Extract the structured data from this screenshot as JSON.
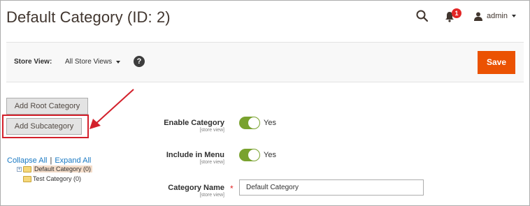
{
  "header": {
    "title": "Default Category (ID: 2)",
    "notifications_count": "1",
    "user_name": "admin"
  },
  "toolbar": {
    "store_view_label": "Store View:",
    "store_view_value": "All Store Views",
    "help_label": "?",
    "save_label": "Save"
  },
  "tree_actions": {
    "add_root_label": "Add Root Category",
    "add_sub_label": "Add Subcategory"
  },
  "tree": {
    "collapse_all": "Collapse All",
    "separator": "|",
    "expand_all": "Expand All",
    "nodes": [
      {
        "label": "Default Category (0)",
        "selected": true
      },
      {
        "label": "Test Category (0)",
        "selected": false
      }
    ]
  },
  "form": {
    "enable_category": {
      "label": "Enable Category",
      "scope": "[store view]",
      "value": "Yes"
    },
    "include_in_menu": {
      "label": "Include in Menu",
      "scope": "[store view]",
      "value": "Yes"
    },
    "category_name": {
      "label": "Category Name",
      "scope": "[store view]",
      "value": "Default Category",
      "required": "*"
    }
  },
  "colors": {
    "accent": "#eb5202",
    "toggle_on": "#79a22e",
    "highlight": "#d3202b",
    "link": "#1979c3"
  }
}
